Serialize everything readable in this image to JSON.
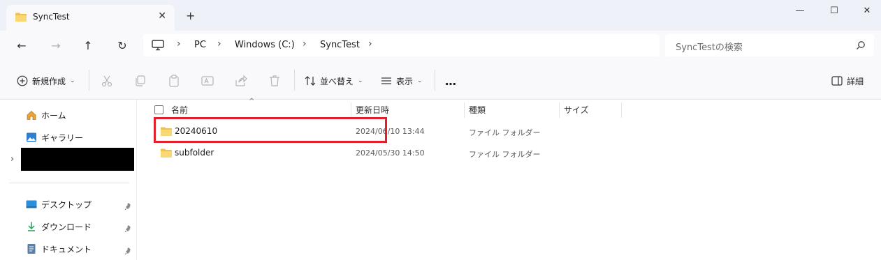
{
  "window": {
    "tab_title": "SyncTest",
    "tab_close": "✕",
    "new_tab": "+",
    "minimize": "—",
    "maximize": "☐",
    "close": "✕"
  },
  "nav": {
    "back": "←",
    "forward": "→",
    "up": "↑",
    "refresh": "↻",
    "breadcrumbs": [
      "PC",
      "Windows (C:)",
      "SyncTest"
    ],
    "separator": "›",
    "search_placeholder": "SyncTestの検索"
  },
  "toolbar": {
    "new_label": "新規作成",
    "sort_label": "並べ替え",
    "view_label": "表示",
    "more_label": "…",
    "details_label": "詳細",
    "chevron": "⌄"
  },
  "sidebar": {
    "items": [
      {
        "label": "ホーム",
        "icon": "home-icon"
      },
      {
        "label": "ギャラリー",
        "icon": "gallery-icon"
      }
    ],
    "expand_chevron": "›",
    "pinned": [
      {
        "label": "デスクトップ",
        "icon": "desktop-icon"
      },
      {
        "label": "ダウンロード",
        "icon": "download-icon"
      },
      {
        "label": "ドキュメント",
        "icon": "document-icon"
      }
    ]
  },
  "columns": {
    "name": "名前",
    "modified": "更新日時",
    "type": "種類",
    "size": "サイズ",
    "sort_caret": "^"
  },
  "files": [
    {
      "name": "20240610",
      "modified": "2024/06/10 13:44",
      "type": "ファイル フォルダー",
      "size": ""
    },
    {
      "name": "subfolder",
      "modified": "2024/05/30 14:50",
      "type": "ファイル フォルダー",
      "size": ""
    }
  ],
  "colors": {
    "folder": "#f3c14b",
    "highlight_border": "#e0202a",
    "chrome": "#eef1f7"
  }
}
